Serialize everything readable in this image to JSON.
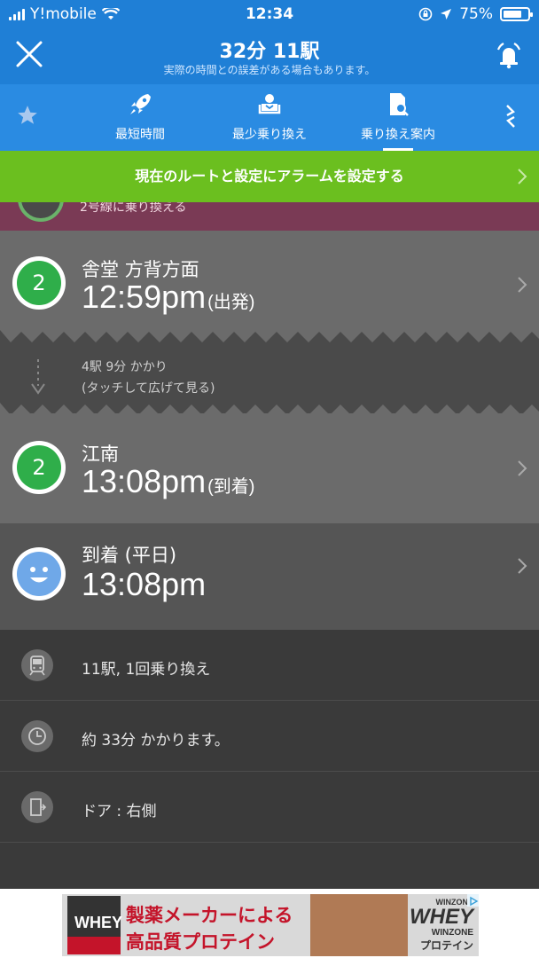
{
  "status": {
    "carrier": "Y!mobile",
    "time": "12:34",
    "battery": "75%",
    "battery_level": 0.75
  },
  "header": {
    "title": "32分 11駅",
    "subtitle": "実際の時間との誤差がある場合もあります。"
  },
  "tabs": [
    {
      "label": "最短時間",
      "icon": "rocket-icon"
    },
    {
      "label": "最少乗り換え",
      "icon": "seat-icon"
    },
    {
      "label": "乗り換え案内",
      "icon": "search-doc-icon",
      "active": true
    }
  ],
  "alarm_banner": "現在のルートと設定にアラームを設定する",
  "prev_segment": "2号線に乗り換える",
  "departure": {
    "line": "2",
    "station": "舎堂 方背方面",
    "time": "12:59pm",
    "tag": "(出発)"
  },
  "ride": {
    "summary": "4駅 9分 かかり",
    "hint": "(タッチして広げて見る)"
  },
  "transfer_stop": {
    "line": "2",
    "station": "江南",
    "time": "13:08pm",
    "tag": "(到着)"
  },
  "arrival": {
    "station": "到着 (平日)",
    "time": "13:08pm"
  },
  "info": [
    {
      "icon": "train-icon",
      "text": "11駅, 1回乗り換え"
    },
    {
      "icon": "clock-icon",
      "text": "約 33分 かかります。"
    },
    {
      "icon": "door-icon",
      "text": "ドア : 右側"
    }
  ],
  "ad": {
    "line1": "製薬メーカーによる",
    "line2": "高品質プロテイン",
    "brand_top": "WINZONE",
    "brand_big": "WHEY",
    "brand_sub": "WINZONE",
    "brand_jp": "プロテイン",
    "product_label": "WHEY"
  },
  "colors": {
    "header": "#1f7fd6",
    "tabs": "#2a8be2",
    "banner": "#6bbf1f",
    "line2": "#2fae4a"
  }
}
